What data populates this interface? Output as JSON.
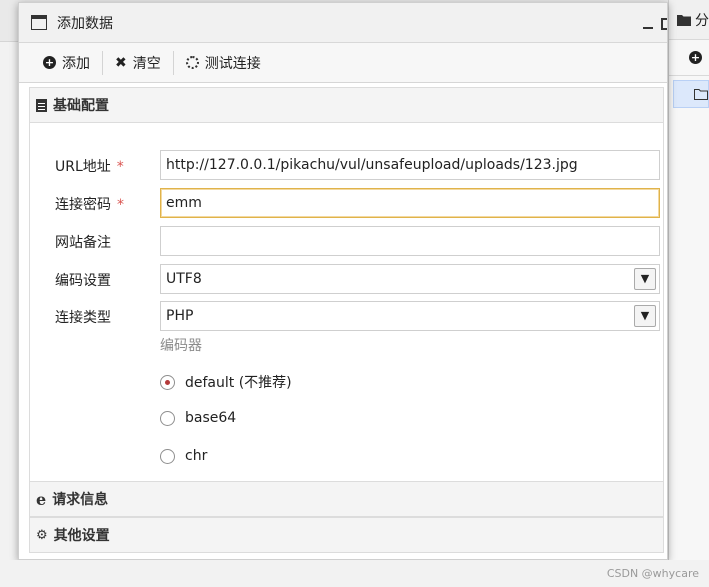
{
  "dialog": {
    "title": "添加数据",
    "window_icon": "window-icon",
    "controls": {
      "minimize": "_",
      "maximize": "□"
    }
  },
  "toolbar": {
    "add_label": "添加",
    "clear_label": "清空",
    "test_label": "测试连接"
  },
  "basic_section": {
    "title": "基础配置",
    "fields": {
      "url": {
        "label": "URL地址",
        "required": "*",
        "value": "http://127.0.0.1/pikachu/vul/unsafeupload/uploads/123.jpg"
      },
      "password": {
        "label": "连接密码",
        "required": "*",
        "value": "emm"
      },
      "note": {
        "label": "网站备注",
        "value": ""
      },
      "encoding": {
        "label": "编码设置",
        "value": "UTF8"
      },
      "type": {
        "label": "连接类型",
        "value": "PHP"
      }
    },
    "encoder": {
      "label": "编码器",
      "options": [
        {
          "label": "default (不推荐)",
          "checked": true
        },
        {
          "label": "base64",
          "checked": false
        },
        {
          "label": "chr",
          "checked": false
        }
      ]
    }
  },
  "request_section": {
    "title": "请求信息"
  },
  "other_section": {
    "title": "其他设置"
  },
  "side_panel": {
    "header_text": "分"
  },
  "watermark": "CSDN @whycare",
  "colors": {
    "required": "#d9534f",
    "focus_border": "#e0b34a",
    "radio_dot": "#b43a3a",
    "selected_row": "#dce8fb"
  }
}
